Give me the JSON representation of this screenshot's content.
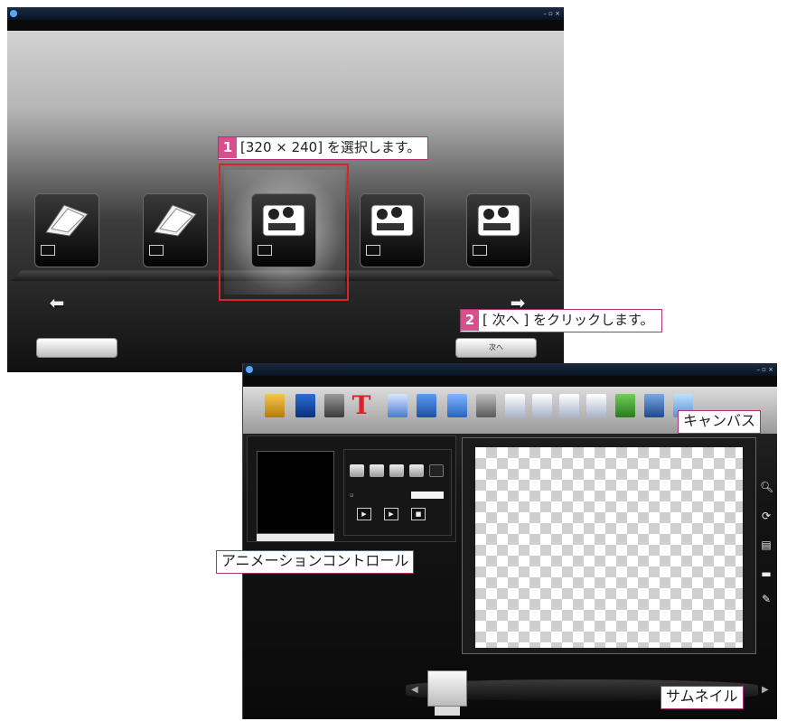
{
  "callouts": {
    "step1": {
      "number": "1",
      "text": "[320 × 240] を選択します。"
    },
    "step2": {
      "number": "2",
      "text": "[ 次へ ] をクリックします。"
    },
    "canvas": "キャンバス",
    "animation_control": "アニメーションコントロール",
    "thumbnail": "サムネイル"
  },
  "size_window": {
    "title": "",
    "menu": [],
    "cards": [],
    "back_label": "",
    "next_label": "次へ"
  },
  "editor_window": {
    "title": "",
    "preview_size": "",
    "thumbnail_number": "",
    "accent_color": "#d8232a",
    "callout_color": "#d94f8e"
  }
}
